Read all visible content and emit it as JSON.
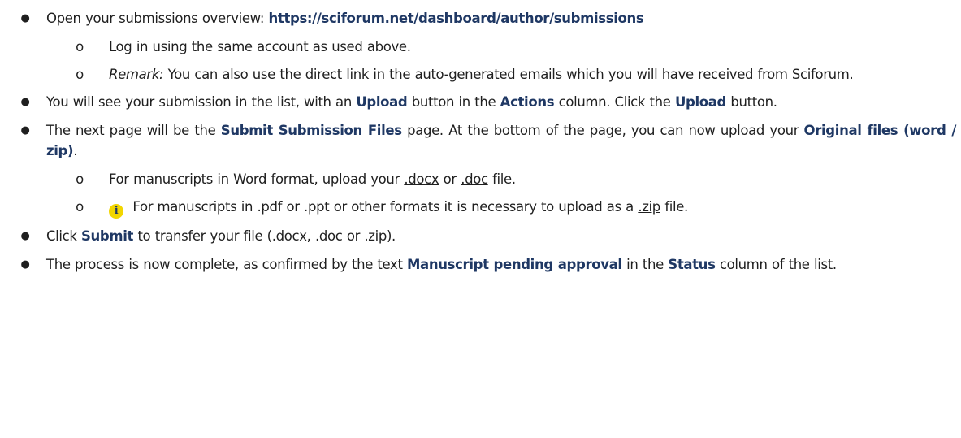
{
  "bullets": {
    "b1": {
      "prefix": "Open your submissions overview: ",
      "link": "https://sciforum.net/dashboard/author/submissions"
    },
    "b1_sub": {
      "s1": "Log in using the same account as used above.",
      "s2_label": "Remark:",
      "s2_text": " You can also use the direct link in the auto-generated emails which you will have received from Sciforum."
    },
    "b2": {
      "t1": "You will see your submission in the list, with an ",
      "upload1": "Upload",
      "t2": " button in the ",
      "actions": "Actions",
      "t3": " column. Click the ",
      "upload2": "Upload",
      "t4": " button."
    },
    "b3": {
      "t1": "The next page will be the ",
      "submit_files": "Submit Submission Files",
      "t2": " page. At the bottom of the page, you can now upload your ",
      "original_files": "Original files (word / zip)",
      "t3": "."
    },
    "b3_sub": {
      "s1_t1": "For manuscripts in Word format, upload your ",
      "docx": ".docx",
      "s1_or": " or ",
      "doc": ".doc",
      "s1_t2": " file.",
      "info_glyph": "i",
      "s2_t1": " For manuscripts in .pdf or .ppt or other formats it is necessary to upload as a ",
      "zip": ".zip",
      "s2_t2": " file."
    },
    "b4": {
      "t1": "Click ",
      "submit": "Submit",
      "t2": " to transfer your file (.docx, .doc or .zip)."
    },
    "b5": {
      "t1": "The process is now complete, as confirmed by the text ",
      "pending": "Manuscript pending approval",
      "t2": " in the ",
      "status": "Status",
      "t3": " column of the list."
    }
  },
  "markers": {
    "bullet": "●",
    "sub": "o"
  },
  "colors": {
    "emphasis": "#1f3864",
    "info_icon_bg": "#f2d600",
    "text": "#1f1f1f"
  }
}
